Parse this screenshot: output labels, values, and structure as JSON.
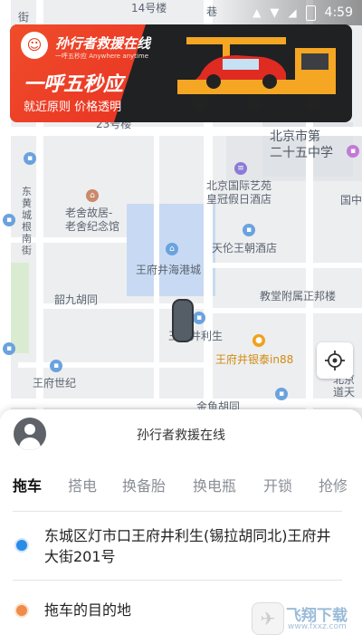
{
  "status_bar": {
    "time": "4:59",
    "wifi_icon": "wifi-icon",
    "battery_icon": "battery-icon"
  },
  "banner": {
    "brand": "孙行者救援在线",
    "brand_sub": "一呼五秒应 Anywhere anytime",
    "slogan": "一呼五秒应",
    "tagline": "就近原则  价格透明",
    "colors": {
      "primary": "#e8392a",
      "dark": "#1f2123",
      "truck": "#f5a623"
    }
  },
  "map": {
    "labels": {
      "l_14": "14号楼",
      "l_jie": "街",
      "l_xiang": "巷",
      "l_beijing_school": "北京市第\n二十五中学",
      "l_dongcheng_road": "东\n黄\n城\n根\n南\n街",
      "l_lao_she": "老舍故居-\n老舍纪念馆",
      "l_art_hotel": "北京国际艺苑\n皇冠假日酒店",
      "l_guo": "国中",
      "l_tianlun": "天伦王朝酒店",
      "l_wfj_mall": "王府井海港城",
      "l_shaojiu": "韶九胡同",
      "l_teacher": "教堂附属正邦楼",
      "l_lisheng": "王府井利生",
      "l_intime": "王府井银泰in88",
      "l_wfj_century": "王府世纪",
      "l_jinyu": "金鱼胡同",
      "l_dongdan": "北京\n道天",
      "l_bldg": "23号楼"
    }
  },
  "sheet": {
    "title": "孙行者救援在线",
    "tabs": [
      "拖车",
      "搭电",
      "换备胎",
      "换电瓶",
      "开锁",
      "抢修"
    ],
    "active_tab": 0,
    "origin_address": "东城区灯市口王府井利生(锡拉胡同北)王府井大街201号",
    "destination_placeholder": "拖车的目的地",
    "origin_dot_color": "#2a8be8",
    "destination_dot_color": "#f08c4a"
  },
  "watermark": {
    "text": "飞翔下载",
    "sub": "www.fxxz.com"
  }
}
